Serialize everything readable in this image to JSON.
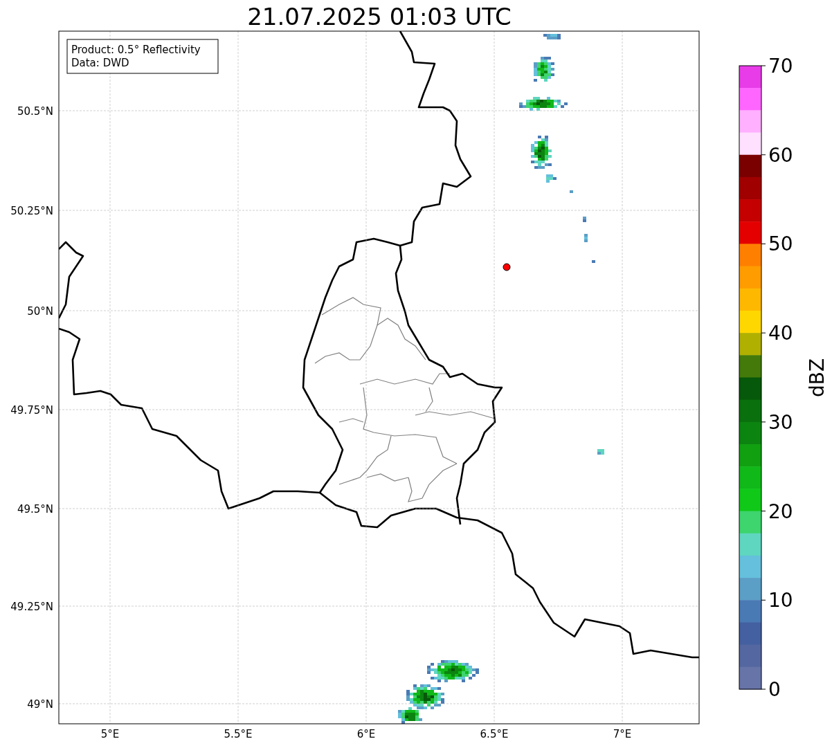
{
  "title": "21.07.2025 01:03 UTC",
  "legend": {
    "lines": [
      "Product: 0.5° Reflectivity",
      "Data: DWD"
    ]
  },
  "map": {
    "lat_labels": [
      "50.5°N",
      "50.25°N",
      "50°N",
      "49.75°N",
      "49.5°N",
      "49.25°N",
      "49°N"
    ],
    "lon_labels": [
      "5°E",
      "5.5°E",
      "6°E",
      "6.5°E",
      "7°E"
    ]
  },
  "colorbar": {
    "label": "dBZ",
    "ticks": [
      "70",
      "60",
      "50",
      "40",
      "30",
      "20",
      "10",
      "0"
    ],
    "segments": [
      {
        "color": "#e83ce8"
      },
      {
        "color": "#ff66ff"
      },
      {
        "color": "#ffb0ff"
      },
      {
        "color": "#ffe0ff"
      },
      {
        "color": "#7a0000"
      },
      {
        "color": "#a00000"
      },
      {
        "color": "#c40000"
      },
      {
        "color": "#e40000"
      },
      {
        "color": "#ff8000"
      },
      {
        "color": "#ff9c00"
      },
      {
        "color": "#ffb800"
      },
      {
        "color": "#ffd700"
      },
      {
        "color": "#b0b000"
      },
      {
        "color": "#437a0a"
      },
      {
        "color": "#06580a"
      },
      {
        "color": "#0a700e"
      },
      {
        "color": "#0c8410"
      },
      {
        "color": "#10a010"
      },
      {
        "color": "#10b818"
      },
      {
        "color": "#10c818"
      },
      {
        "color": "#3ed46e"
      },
      {
        "color": "#5fd6c0"
      },
      {
        "color": "#64c0dc"
      },
      {
        "color": "#5b9ec6"
      },
      {
        "color": "#4a7ab4"
      },
      {
        "color": "#4460a0"
      },
      {
        "color": "#5567a0"
      },
      {
        "color": "#6674a8"
      }
    ]
  }
}
